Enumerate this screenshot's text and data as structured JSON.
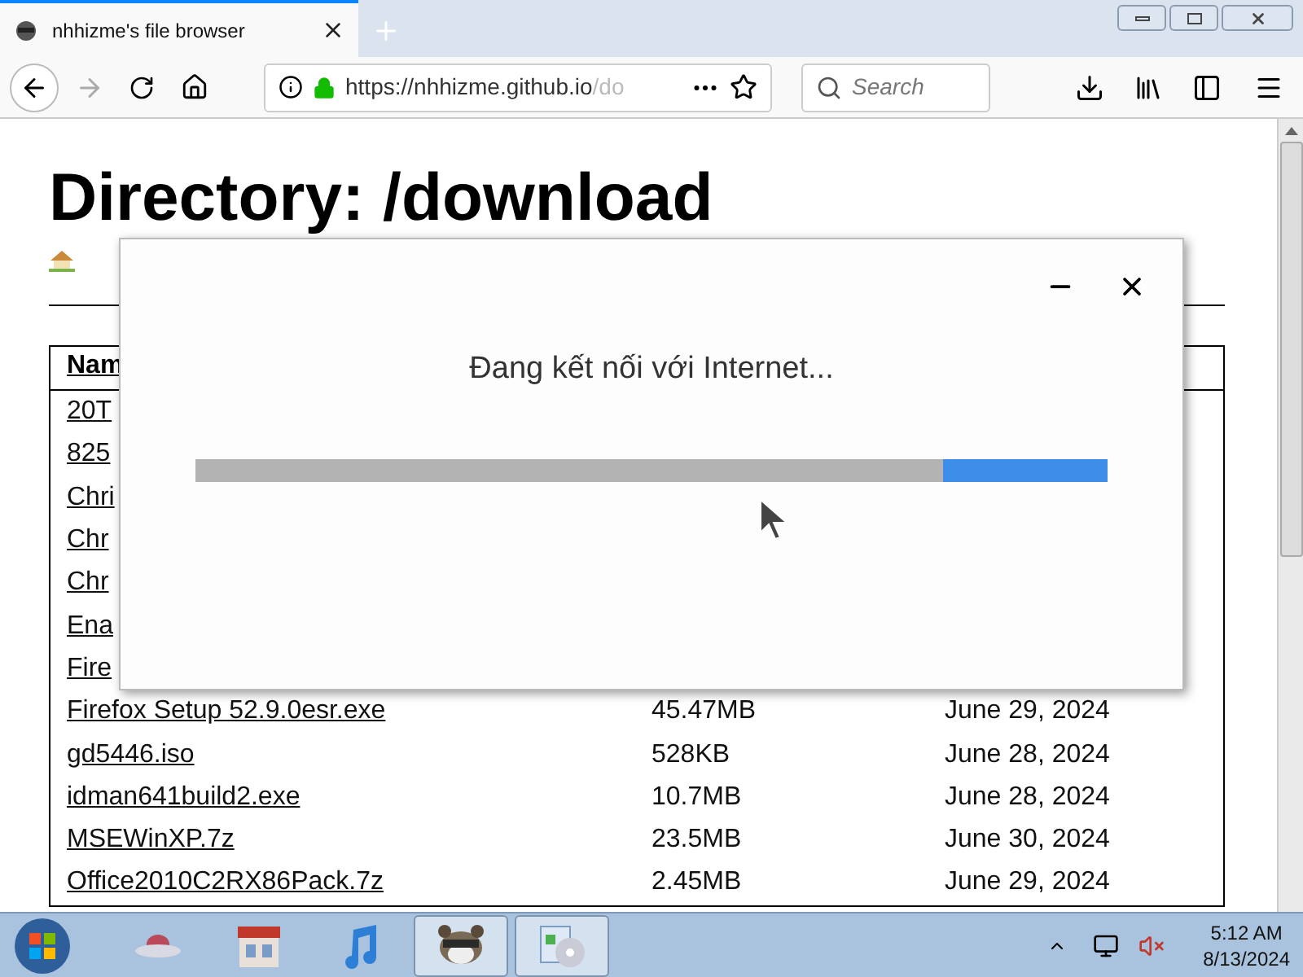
{
  "browser": {
    "tabs": [
      {
        "title": "nhhizme's file browser",
        "selected": true
      }
    ],
    "url": {
      "scheme": "https://",
      "host": "nhhizme.github.io",
      "path": "/do"
    },
    "search": {
      "placeholder": "Search"
    }
  },
  "page": {
    "heading": "Directory: /download",
    "table": {
      "columns": [
        "Nam"
      ],
      "rows": [
        {
          "name": "20T"
        },
        {
          "name": "825"
        },
        {
          "name": "Chri"
        },
        {
          "name": "Chr"
        },
        {
          "name": "Chr"
        },
        {
          "name": "Ena"
        },
        {
          "name": "Fire"
        },
        {
          "name": "Firefox Setup 52.9.0esr.exe",
          "size": "45.47MB",
          "date": "June 29, 2024"
        },
        {
          "name": "gd5446.iso",
          "size": "528KB",
          "date": "June 28, 2024"
        },
        {
          "name": "idman641build2.exe",
          "size": "10.7MB",
          "date": "June 28, 2024"
        },
        {
          "name": "MSEWinXP.7z",
          "size": "23.5MB",
          "date": "June 30, 2024"
        },
        {
          "name": "Office2010C2RX86Pack.7z",
          "size": "2.45MB",
          "date": "June 29, 2024"
        }
      ]
    }
  },
  "dialog": {
    "message": "Đang kết nối với Internet...",
    "progress": {
      "level": 0.18
    }
  },
  "taskbar": {
    "items": [
      {
        "kind": "saucer",
        "open": false
      },
      {
        "kind": "store",
        "open": false
      },
      {
        "kind": "music",
        "open": false
      },
      {
        "kind": "raccoon",
        "open": true
      },
      {
        "kind": "installer",
        "open": true
      }
    ],
    "clock": {
      "time": "5:12 AM",
      "date": "8/13/2024"
    }
  }
}
